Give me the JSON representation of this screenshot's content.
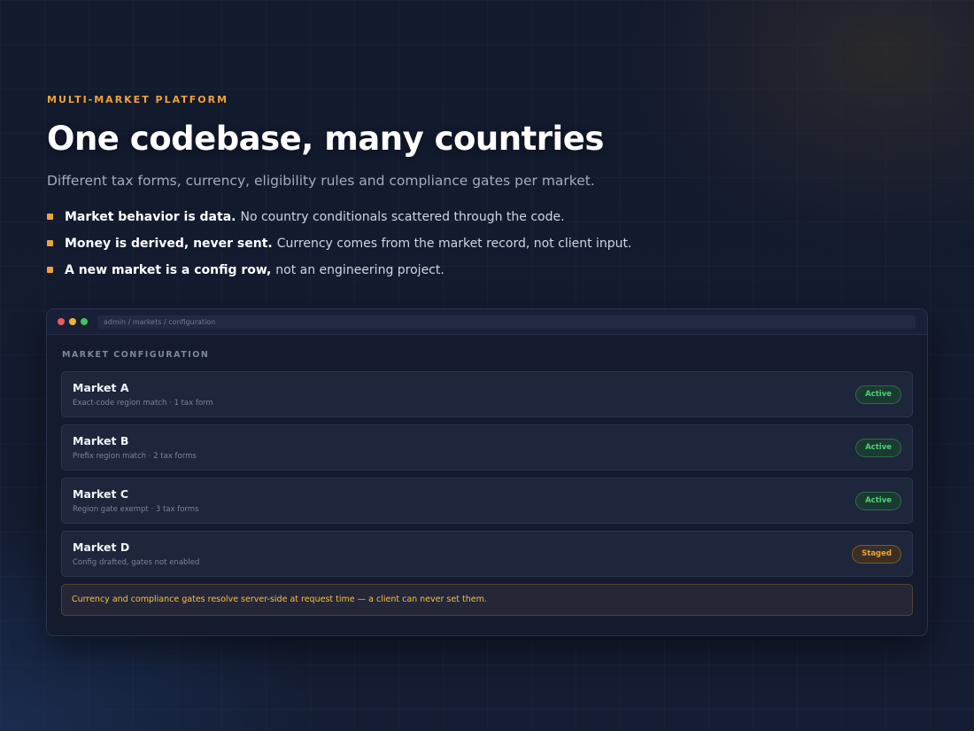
{
  "hero": {
    "eyebrow": "MULTI-MARKET PLATFORM",
    "headline": "One codebase, many countries",
    "subtitle": "Different tax forms, currency, eligibility rules and compliance gates per market.",
    "bullets": [
      {
        "strong": "Market behavior is data.",
        "text": "No country conditionals scattered through the code."
      },
      {
        "strong": "Money is derived, never sent.",
        "text": "Currency comes from the market record, not client input."
      },
      {
        "strong": "A new market is a config row,",
        "text": "not an engineering project."
      }
    ]
  },
  "window": {
    "breadcrumb": "admin / markets / configuration",
    "section_label": "MARKET CONFIGURATION",
    "markets": [
      {
        "name": "Market A",
        "description": "Exact-code region match · 1 tax form",
        "status": "Active"
      },
      {
        "name": "Market B",
        "description": "Prefix region match · 2 tax forms",
        "status": "Active"
      },
      {
        "name": "Market C",
        "description": "Region gate exempt · 3 tax forms",
        "status": "Active"
      },
      {
        "name": "Market D",
        "description": "Config drafted, gates not enabled",
        "status": "Staged"
      }
    ],
    "notice": "Currency and compliance gates resolve server-side at request time — a client can never set them."
  },
  "colors": {
    "accent": "#f0a23a",
    "active": "#4fd27a",
    "staged": "#f0a23a",
    "notice_text": "#f0c24a",
    "background": "#121a2d"
  },
  "icons": {
    "window_controls": [
      "close-dot",
      "minimize-dot",
      "maximize-dot"
    ],
    "bullet": "square-bullet-icon"
  }
}
